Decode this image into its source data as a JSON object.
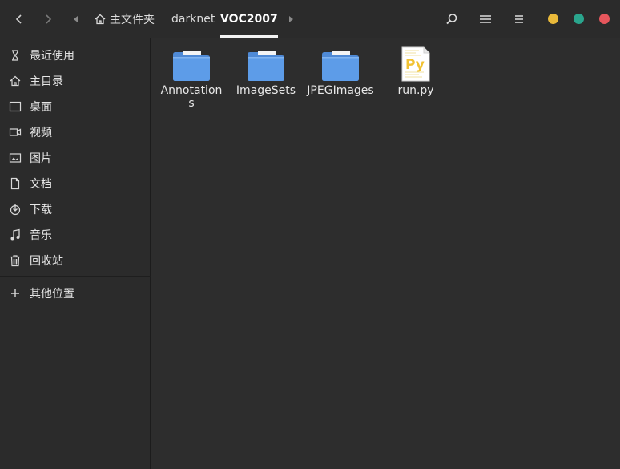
{
  "header": {
    "back_icon": "chevron-left-icon",
    "forward_icon": "chevron-right-icon",
    "breadcrumb": {
      "home_label": "主文件夹",
      "darknet_label": "darknet",
      "current_label": "VOC2007"
    },
    "tools": {
      "search_icon": "search-icon",
      "view_icon": "list-view-icon",
      "menu_icon": "hamburger-menu-icon"
    },
    "window_controls": {
      "minimize_color": "#e9b93a",
      "maximize_color": "#2aa58d",
      "close_color": "#e6565c"
    }
  },
  "sidebar": {
    "items": [
      {
        "label": "最近使用",
        "icon": "clock-icon"
      },
      {
        "label": "主目录",
        "icon": "home-icon"
      },
      {
        "label": "桌面",
        "icon": "desktop-icon"
      },
      {
        "label": "视频",
        "icon": "video-icon"
      },
      {
        "label": "图片",
        "icon": "picture-icon"
      },
      {
        "label": "文档",
        "icon": "document-icon"
      },
      {
        "label": "下载",
        "icon": "download-icon"
      },
      {
        "label": "音乐",
        "icon": "music-icon"
      },
      {
        "label": "回收站",
        "icon": "trash-icon"
      }
    ],
    "other_locations": {
      "label": "其他位置",
      "icon": "plus-icon"
    }
  },
  "files": [
    {
      "name": "Annotations",
      "type": "folder"
    },
    {
      "name": "ImageSets",
      "type": "folder"
    },
    {
      "name": "JPEGImages",
      "type": "folder"
    },
    {
      "name": "run.py",
      "type": "python-file"
    }
  ],
  "colors": {
    "folder_blue": "#5b9ae6",
    "accent_white": "#f2f2f2"
  }
}
